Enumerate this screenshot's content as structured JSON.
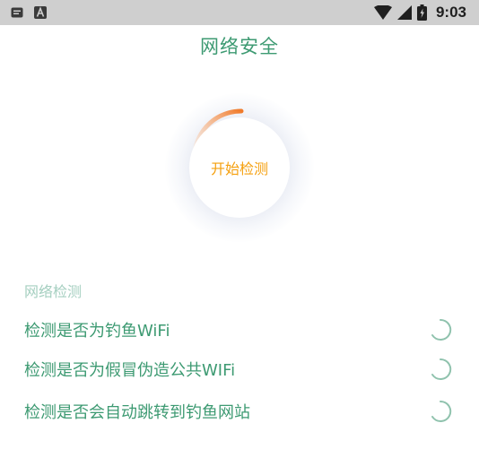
{
  "status_bar": {
    "time": "9:03",
    "icons": [
      "message-icon",
      "a-badge-icon",
      "wifi-icon",
      "signal-icon",
      "battery-icon"
    ]
  },
  "header": {
    "title": "网络安全"
  },
  "scan": {
    "button_label": "开始检测",
    "progress_color": "#f07a2a",
    "label_color": "#f5a00f"
  },
  "section": {
    "title": "网络检测",
    "items": [
      {
        "label": "检测是否为钓鱼WiFi",
        "status_icon": "loading-icon"
      },
      {
        "label": "检测是否为假冒伪造公共WIFi",
        "status_icon": "loading-icon"
      },
      {
        "label": "检测是否会自动跳转到钓鱼网站",
        "status_icon": "loading-icon"
      }
    ]
  },
  "colors": {
    "accent": "#3d9a72",
    "section_header": "#a5cfc0",
    "status_bar_bg": "#cfcfcf"
  }
}
